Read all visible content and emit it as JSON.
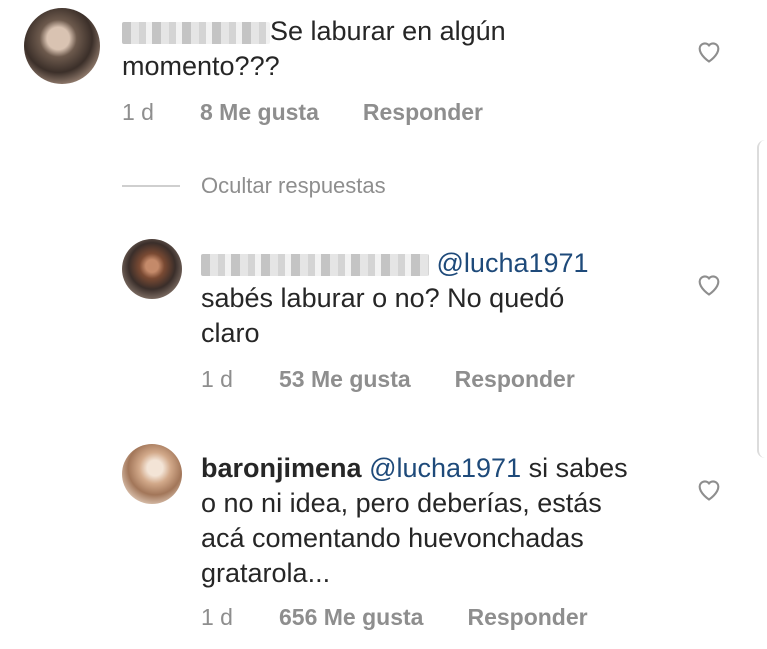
{
  "comments": [
    {
      "text_before": "",
      "text": "Se laburar en algún momento???",
      "line1": "Se laburar en algún",
      "line2": "momento???",
      "time": "1 d",
      "likes": "8 Me gusta",
      "reply": "Responder"
    },
    {
      "mention": "@lucha1971",
      "line1": "sabés laburar o no? No quedó",
      "line2": "claro",
      "time": "1 d",
      "likes": "53 Me gusta",
      "reply": "Responder"
    },
    {
      "username": "baronjimena",
      "mention": "@lucha1971",
      "line1_rest": "si sabes",
      "line2": "o no ni idea, pero deberías, estás",
      "line3": "acá comentando huevonchadas",
      "line4": "gratarola...",
      "time": "1 d",
      "likes": "656 Me gusta",
      "reply": "Responder"
    }
  ],
  "hide_replies": "Ocultar respuestas",
  "icons": {
    "heart": "heart-outline-icon"
  }
}
